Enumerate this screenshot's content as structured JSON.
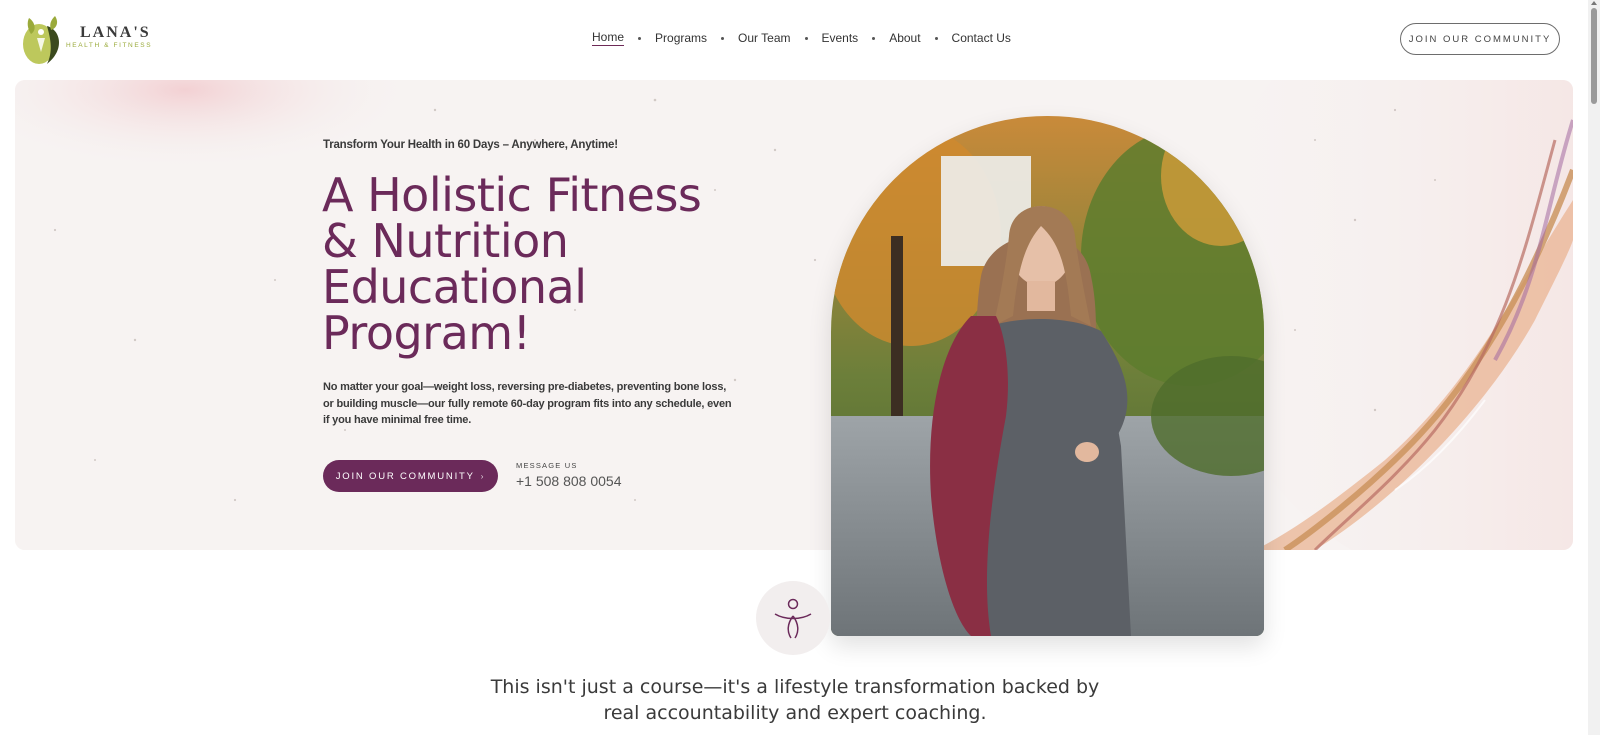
{
  "brand": {
    "name": "LANA'S",
    "tagline": "HEALTH & FITNESS"
  },
  "nav": {
    "items": [
      "Home",
      "Programs",
      "Our Team",
      "Events",
      "About",
      "Contact Us"
    ],
    "active": "Home"
  },
  "header": {
    "cta_label": "JOIN OUR COMMUNITY"
  },
  "hero": {
    "eyebrow": "Transform Your Health in 60 Days – Anywhere, Anytime!",
    "title": "A Holistic Fitness & Nutrition Educational Program!",
    "description": "No matter your goal—weight loss, reversing pre-diabetes, preventing bone loss, or building muscle—our fully remote 60-day program fits into any schedule, even if you have minimal free time.",
    "cta_label": "JOIN OUR COMMUNITY",
    "cta_icon": "arrow-right-icon",
    "message_label": "MESSAGE US",
    "phone": "+1 508 808 0054"
  },
  "section": {
    "emblem_icon": "figure-icon",
    "tagline": "This isn't just a course—it's a lifestyle transformation backed by real accountability and expert coaching."
  },
  "colors": {
    "brand_plum": "#6b2a5a",
    "brand_green": "#9aaa3a"
  }
}
